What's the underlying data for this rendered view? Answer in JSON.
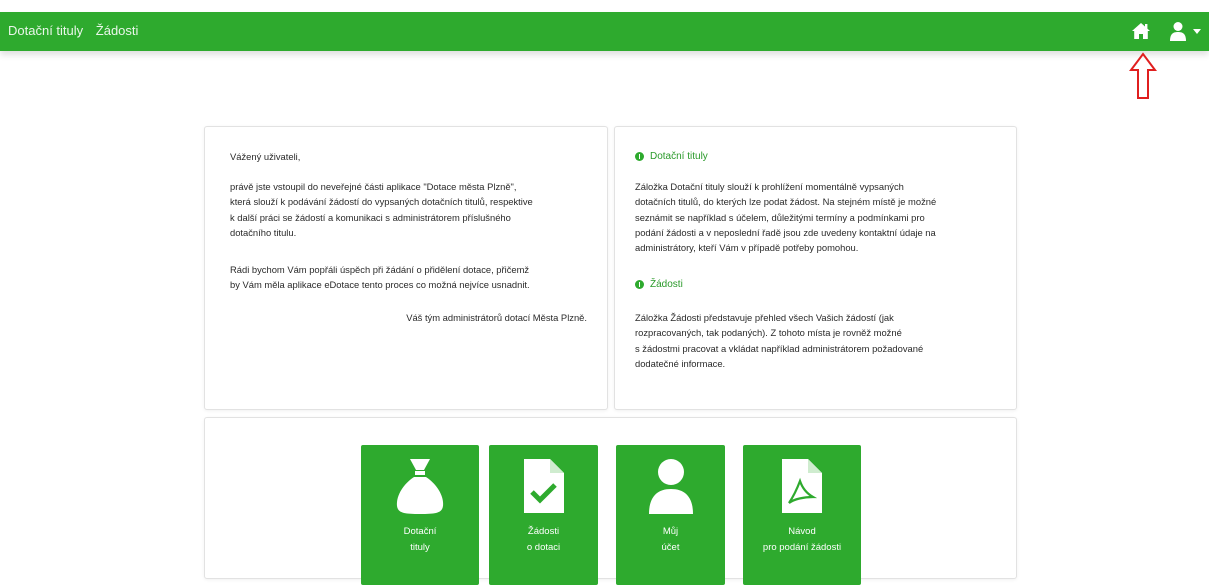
{
  "topbar": {
    "nav_items": [
      "Dotační tituly",
      "Žádosti"
    ],
    "colors": {
      "brand": "#2eaa2e",
      "text_light": "#eaf6ea",
      "annotation_arrow": "#e01f1f"
    }
  },
  "welcome": {
    "greeting": "Vážený uživateli,",
    "p1_lines": [
      "právě jste vstoupil do neveřejné části aplikace \"Dotace města Plzně\",",
      "která slouží k podávání žádostí do vypsaných dotačních titulů, respektive",
      "k další práci se žádostí a komunikaci s administrátorem příslušného",
      "dotačního titulu."
    ],
    "p2_lines": [
      "Rádi bychom Vám popřáli úspěch při žádání o přidělení dotace, přičemž",
      "by Vám měla aplikace eDotace tento proces co možná nejvíce usnadnit."
    ],
    "signature": "Váš tým administrátorů dotací Města Plzně."
  },
  "info": {
    "section1_title": "Dotační tituly",
    "section1_lines": [
      "Záložka Dotační tituly slouží k prohlížení momentálně vypsaných",
      "dotačních titulů, do kterých lze podat žádost. Na stejném místě je možné",
      "seznámit se například s účelem, důležitými termíny a podmínkami pro",
      "podání žádosti a v neposlední řadě jsou zde uvedeny kontaktní údaje na",
      "administrátory, kteří Vám v případě potřeby pomohou."
    ],
    "section2_title": "Žádosti",
    "section2_lines": [
      "Záložka Žádosti představuje přehled všech Vašich žádostí (jak",
      "rozpracovaných, tak podaných). Z tohoto místa je rovněž možné",
      "s žádostmi pracovat a vkládat například administrátorem požadované",
      "dodatečné informace."
    ]
  },
  "tiles": [
    {
      "icon": "money-bag-icon",
      "line1": "Dotační",
      "line2": "tituly"
    },
    {
      "icon": "document-check-icon",
      "line1": "Žádosti",
      "line2": "o dotaci"
    },
    {
      "icon": "user-icon",
      "line1": "Můj",
      "line2": "účet"
    },
    {
      "icon": "pdf-document-icon",
      "line1": "Návod",
      "line2": "pro podání žádosti"
    }
  ]
}
